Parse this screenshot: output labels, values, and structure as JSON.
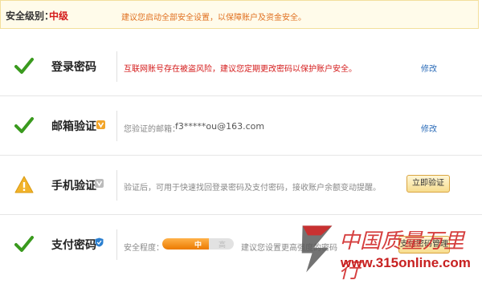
{
  "banner": {
    "level_label": "安全级别：",
    "level_value": "中级",
    "tip": "建议您启动全部安全设置，以保障账户及资金安全。"
  },
  "rows": [
    {
      "title": "登录密码",
      "status": "ok",
      "description": "互联网账号存在被盗风险，建议您定期更改密码以保护账户安全。",
      "action": "修改"
    },
    {
      "title": "邮箱验证",
      "status": "ok",
      "description_label": "您验证的邮箱：",
      "description_value": "f3*****ou@163.com",
      "action": "修改"
    },
    {
      "title": "手机验证",
      "status": "warning",
      "description": "验证后，可用于快速找回登录密码及支付密码，接收账户余额变动提醒。",
      "action": "立即验证"
    },
    {
      "title": "支付密码",
      "status": "ok",
      "strength_label": "安全程度：",
      "strength_value": "中",
      "strength_high": "高",
      "strength_level": 0.65,
      "suggestion": "建议您设置更高强度的密码",
      "action": "支付密码管理"
    }
  ],
  "watermark": {
    "text": "中国质量万里行",
    "url": "www.315online.com"
  },
  "colors": {
    "ok_green": "#3a9a1e",
    "warning_yellow": "#f2b32a",
    "alert_red": "#d41a1a",
    "link_blue": "#2a6bb8",
    "meter_orange": "#ec7a00"
  }
}
